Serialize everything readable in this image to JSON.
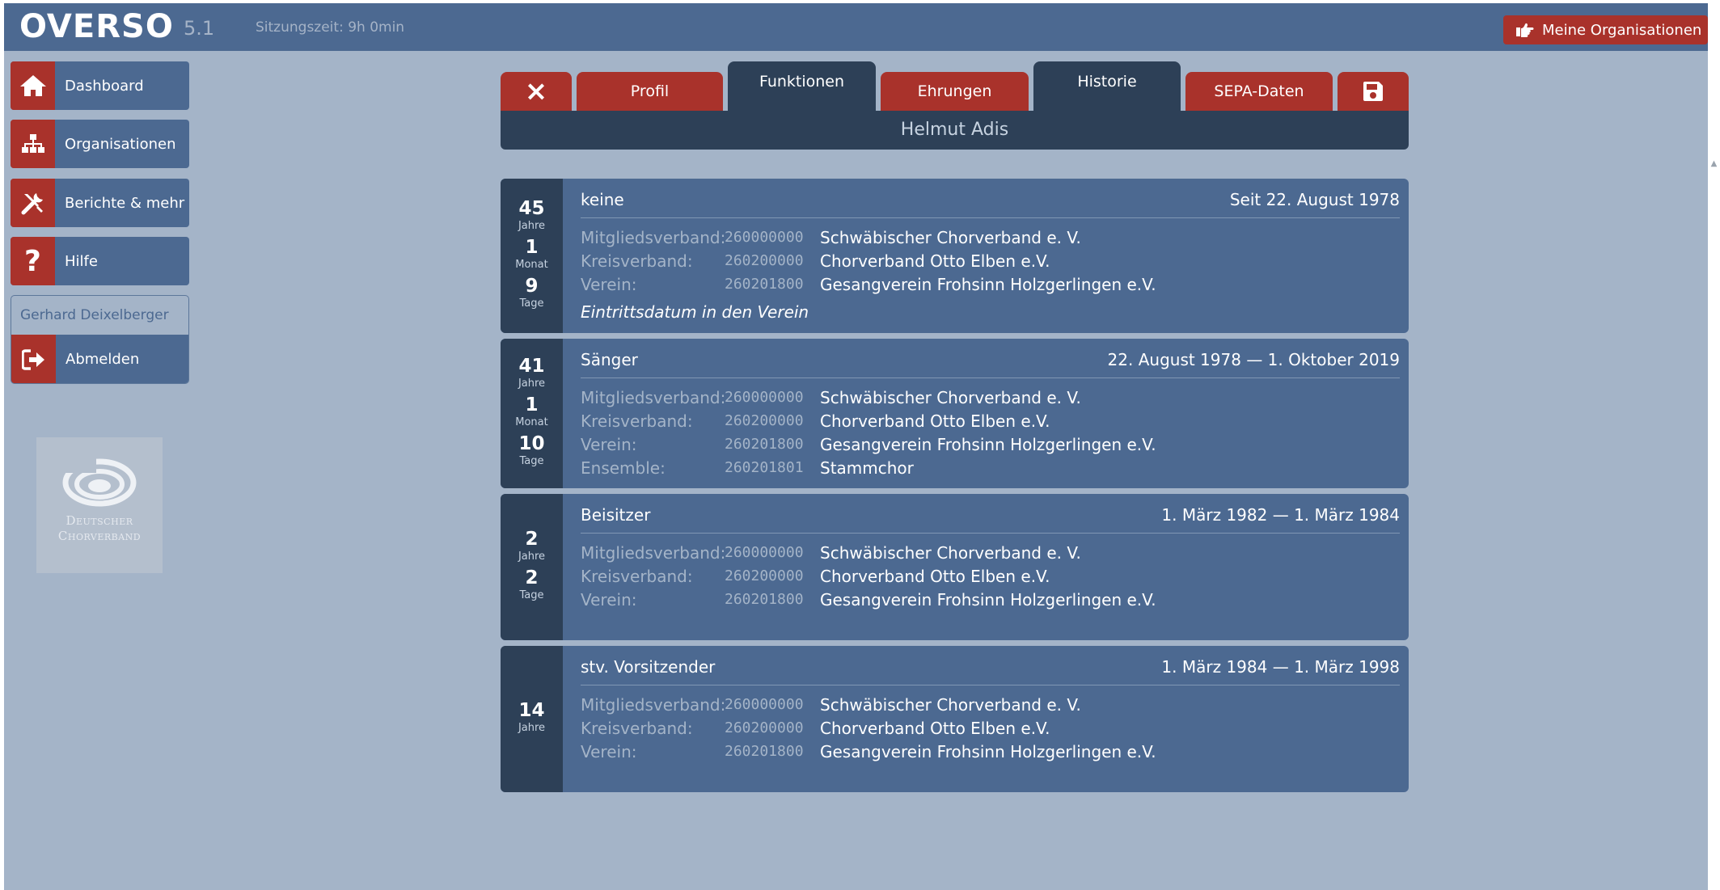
{
  "header": {
    "logo": "OVERSO",
    "version": "5.1",
    "session": "Sitzungszeit: 9h 0min",
    "orgs_button": "Meine Organisationen"
  },
  "sidebar": {
    "items": [
      {
        "label": "Dashboard",
        "icon": "home-icon"
      },
      {
        "label": "Organisationen",
        "icon": "sitemap-icon"
      },
      {
        "label": "Berichte & mehr",
        "icon": "tools-icon"
      },
      {
        "label": "Hilfe",
        "icon": "question-icon"
      }
    ],
    "user": "Gerhard Deixelberger",
    "logout": "Abmelden",
    "logo_text_1": "Deutscher",
    "logo_text_2": "Chorverband"
  },
  "tabs": {
    "close": "×",
    "profil": "Profil",
    "funktionen": "Funktionen",
    "ehrungen": "Ehrungen",
    "historie": "Historie",
    "sepa": "SEPA-Daten",
    "save_icon": "save-icon"
  },
  "person_name": "Helmut Adis",
  "cards": [
    {
      "duration": [
        {
          "n": "45",
          "u": "Jahre"
        },
        {
          "n": "1",
          "u": "Monat"
        },
        {
          "n": "9",
          "u": "Tage"
        }
      ],
      "title": "keine",
      "date": "Seit 22. August 1978",
      "rows": [
        {
          "label": "Mitgliedsverband:",
          "code": "260000000",
          "value": "Schwäbischer Chorverband e. V."
        },
        {
          "label": "Kreisverband:",
          "code": "260200000",
          "value": "Chorverband Otto Elben e.V."
        },
        {
          "label": "Verein:",
          "code": "260201800",
          "value": "Gesangverein Frohsinn Holzgerlingen e.V."
        }
      ],
      "note": "Eintrittsdatum in den Verein"
    },
    {
      "duration": [
        {
          "n": "41",
          "u": "Jahre"
        },
        {
          "n": "1",
          "u": "Monat"
        },
        {
          "n": "10",
          "u": "Tage"
        }
      ],
      "title": "Sänger",
      "date": "22. August 1978 — 1. Oktober 2019",
      "rows": [
        {
          "label": "Mitgliedsverband:",
          "code": "260000000",
          "value": "Schwäbischer Chorverband e. V."
        },
        {
          "label": "Kreisverband:",
          "code": "260200000",
          "value": "Chorverband Otto Elben e.V."
        },
        {
          "label": "Verein:",
          "code": "260201800",
          "value": "Gesangverein Frohsinn Holzgerlingen e.V."
        },
        {
          "label": "Ensemble:",
          "code": "260201801",
          "value": "Stammchor"
        }
      ]
    },
    {
      "duration": [
        {
          "n": "2",
          "u": "Jahre"
        },
        {
          "n": "2",
          "u": "Tage"
        }
      ],
      "title": "Beisitzer",
      "date": "1. März 1982 — 1. März 1984",
      "rows": [
        {
          "label": "Mitgliedsverband:",
          "code": "260000000",
          "value": "Schwäbischer Chorverband e. V."
        },
        {
          "label": "Kreisverband:",
          "code": "260200000",
          "value": "Chorverband Otto Elben e.V."
        },
        {
          "label": "Verein:",
          "code": "260201800",
          "value": "Gesangverein Frohsinn Holzgerlingen e.V."
        }
      ]
    },
    {
      "duration": [
        {
          "n": "14",
          "u": "Jahre"
        }
      ],
      "title": "stv. Vorsitzender",
      "date": "1. März 1984 — 1. März 1998",
      "rows": [
        {
          "label": "Mitgliedsverband:",
          "code": "260000000",
          "value": "Schwäbischer Chorverband e. V."
        },
        {
          "label": "Kreisverband:",
          "code": "260200000",
          "value": "Chorverband Otto Elben e.V."
        },
        {
          "label": "Verein:",
          "code": "260201800",
          "value": "Gesangverein Frohsinn Holzgerlingen e.V."
        }
      ]
    }
  ]
}
